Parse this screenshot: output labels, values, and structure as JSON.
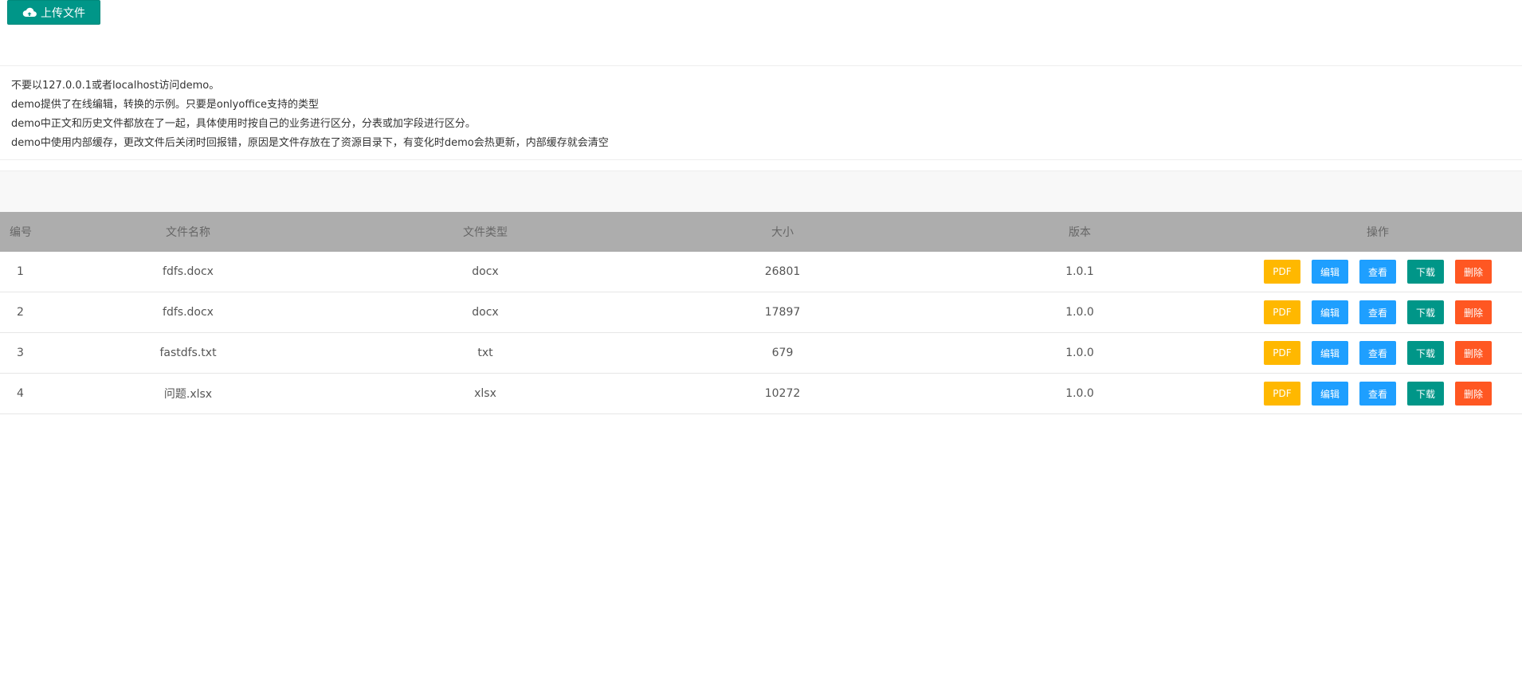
{
  "toolbar": {
    "upload_label": "上传文件",
    "upload_icon": "cloud-upload-icon"
  },
  "notes": [
    "不要以127.0.0.1或者localhost访问demo。",
    "demo提供了在线编辑，转换的示例。只要是onlyoffice支持的类型",
    "demo中正文和历史文件都放在了一起，具体使用时按自己的业务进行区分，分表或加字段进行区分。",
    "demo中使用内部缓存，更改文件后关闭时回报错，原因是文件存放在了资源目录下，有变化时demo会热更新，内部缓存就会清空"
  ],
  "table": {
    "headers": {
      "id": "编号",
      "name": "文件名称",
      "type": "文件类型",
      "size": "大小",
      "version": "版本",
      "ops": "操作"
    },
    "rows": [
      {
        "id": "1",
        "name": "fdfs.docx",
        "type": "docx",
        "size": "26801",
        "version": "1.0.1"
      },
      {
        "id": "2",
        "name": "fdfs.docx",
        "type": "docx",
        "size": "17897",
        "version": "1.0.0"
      },
      {
        "id": "3",
        "name": "fastdfs.txt",
        "type": "txt",
        "size": "679",
        "version": "1.0.0"
      },
      {
        "id": "4",
        "name": "问题.xlsx",
        "type": "xlsx",
        "size": "10272",
        "version": "1.0.0"
      }
    ],
    "actions": {
      "pdf": "PDF",
      "edit": "编辑",
      "view": "查看",
      "download": "下载",
      "delete": "删除"
    }
  },
  "colors": {
    "primary": "#009688",
    "warm": "#FFB800",
    "normal": "#1E9FFF",
    "danger": "#FF5722",
    "header_bg": "#adadad"
  }
}
